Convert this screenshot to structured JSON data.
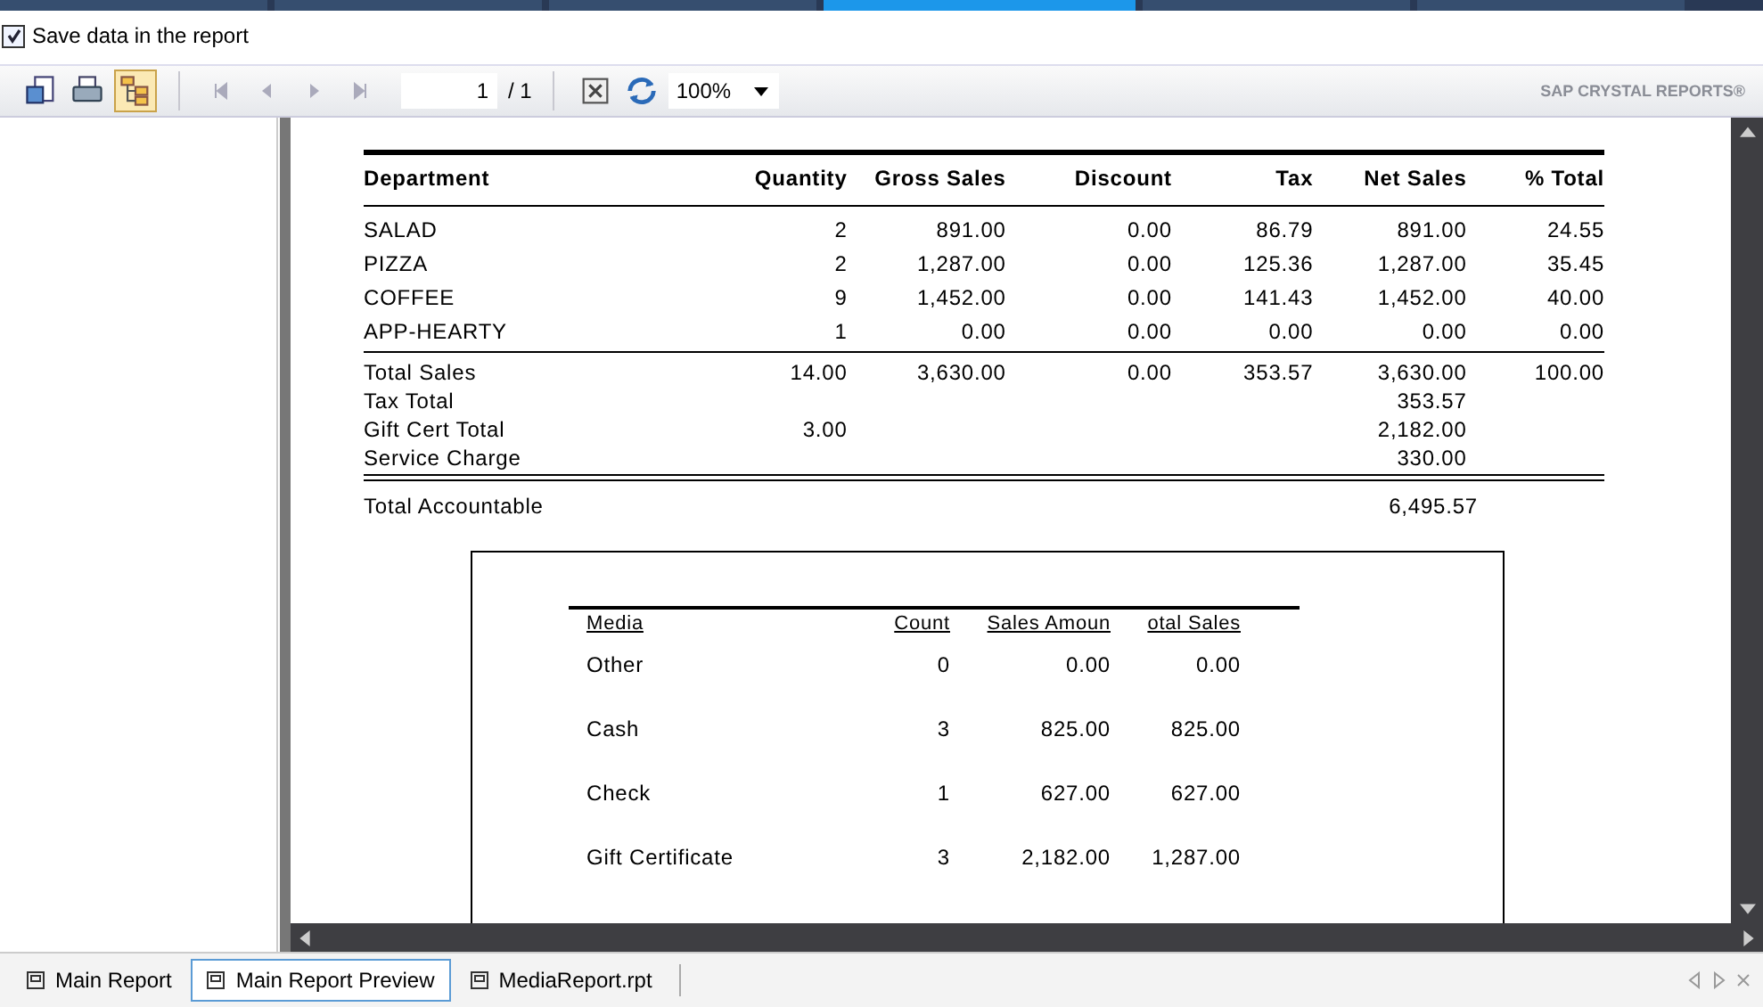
{
  "doc_tabs": [
    {
      "selected": false
    },
    {
      "selected": false
    },
    {
      "selected": false
    },
    {
      "selected": true
    },
    {
      "selected": false
    },
    {
      "selected": false
    }
  ],
  "save_option": {
    "label": "Save data in the report",
    "checked": true
  },
  "toolbar": {
    "page": "1",
    "page_total": "/ 1",
    "zoom": "100%",
    "brand": "SAP CRYSTAL REPORTS®"
  },
  "report": {
    "columns": [
      "Department",
      "Quantity",
      "Gross Sales",
      "Discount",
      "Tax",
      "Net Sales",
      "% Total"
    ],
    "rows": [
      [
        "SALAD",
        "2",
        "891.00",
        "0.00",
        "86.79",
        "891.00",
        "24.55"
      ],
      [
        "PIZZA",
        "2",
        "1,287.00",
        "0.00",
        "125.36",
        "1,287.00",
        "35.45"
      ],
      [
        "COFFEE",
        "9",
        "1,452.00",
        "0.00",
        "141.43",
        "1,452.00",
        "40.00"
      ],
      [
        "APP-HEARTY",
        "1",
        "0.00",
        "0.00",
        "0.00",
        "0.00",
        "0.00"
      ]
    ],
    "totals": [
      {
        "label": "Total Sales",
        "quantity": "14.00",
        "gross_sales": "3,630.00",
        "discount": "0.00",
        "tax": "353.57",
        "net_sales": "3,630.00",
        "pct_total": "100.00"
      },
      {
        "label": "Tax Total",
        "net_sales": "353.57"
      },
      {
        "label": "Gift Cert Total",
        "quantity": "3.00",
        "net_sales": "2,182.00"
      },
      {
        "label": "Service Charge",
        "net_sales": "330.00"
      }
    ],
    "accountable": {
      "label": "Total Accountable",
      "value": "6,495.57"
    },
    "media": {
      "columns": [
        "Media",
        "Count",
        "Sales Amoun",
        "otal Sales"
      ],
      "rows": [
        [
          "Other",
          "0",
          "0.00",
          "0.00"
        ],
        [
          "Cash",
          "3",
          "825.00",
          "825.00"
        ],
        [
          "Check",
          "1",
          "627.00",
          "627.00"
        ],
        [
          "Gift Certificate",
          "3",
          "2,182.00",
          "1,287.00"
        ]
      ]
    }
  },
  "bottom_tabs": [
    {
      "label": "Main Report",
      "selected": false
    },
    {
      "label": "Main Report Preview",
      "selected": true
    },
    {
      "label": "MediaReport.rpt",
      "selected": false
    }
  ]
}
